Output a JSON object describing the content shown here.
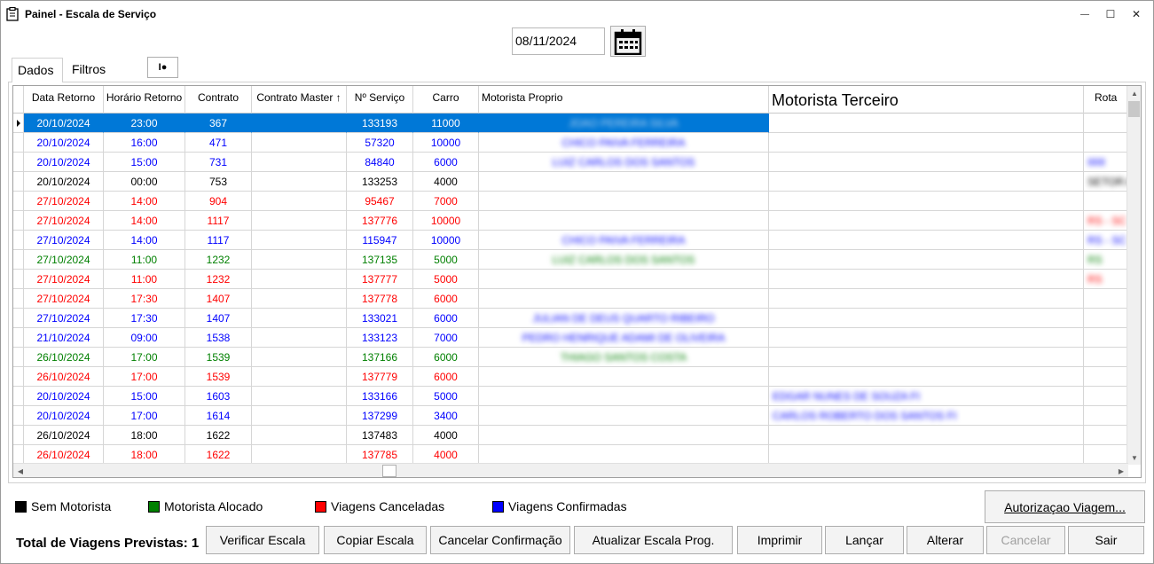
{
  "window": {
    "title": "Painel - Escala de Serviço",
    "minimize_glyph": "—",
    "maximize_glyph": "☐",
    "close_glyph": "✕"
  },
  "date_field": {
    "value": "08/11/2024"
  },
  "tabs": [
    {
      "label": "Dados"
    },
    {
      "label": "Filtros"
    }
  ],
  "small_button": {
    "glyph": "I●"
  },
  "grid": {
    "columns": [
      "Data Retorno",
      "Horário Retorno",
      "Contrato",
      "Contrato Master ↑",
      "Nº Serviço",
      "Carro",
      "Motorista Proprio",
      "Motorista Terceiro",
      "Rota"
    ],
    "rows": [
      {
        "date": "20/10/2024",
        "time": "23:00",
        "contract": "367",
        "master": "",
        "service": "133193",
        "car": "11000",
        "color": "#ffffff",
        "selected": true,
        "own_driver": "JOAO PEREIRA SILVA",
        "third_driver": "",
        "route": ""
      },
      {
        "date": "20/10/2024",
        "time": "16:00",
        "contract": "471",
        "master": "",
        "service": "57320",
        "car": "10000",
        "color": "#0000ff",
        "selected": false,
        "own_driver": "CHICO PAIVA FERREIRA",
        "third_driver": "",
        "route": ""
      },
      {
        "date": "20/10/2024",
        "time": "15:00",
        "contract": "731",
        "master": "",
        "service": "84840",
        "car": "6000",
        "color": "#0000ff",
        "selected": false,
        "own_driver": "LUIZ CARLOS DOS SANTOS",
        "third_driver": "",
        "route": "IIIIII"
      },
      {
        "date": "20/10/2024",
        "time": "00:00",
        "contract": "753",
        "master": "",
        "service": "133253",
        "car": "4000",
        "color": "#000000",
        "selected": false,
        "own_driver": "",
        "third_driver": "",
        "route": "SETOR A"
      },
      {
        "date": "27/10/2024",
        "time": "14:00",
        "contract": "904",
        "master": "",
        "service": "95467",
        "car": "7000",
        "color": "#ff0000",
        "selected": false,
        "own_driver": "",
        "third_driver": "",
        "route": ""
      },
      {
        "date": "27/10/2024",
        "time": "14:00",
        "contract": "1117",
        "master": "",
        "service": "137776",
        "car": "10000",
        "color": "#ff0000",
        "selected": false,
        "own_driver": "",
        "third_driver": "",
        "route": "RS - SC"
      },
      {
        "date": "27/10/2024",
        "time": "14:00",
        "contract": "1117",
        "master": "",
        "service": "115947",
        "car": "10000",
        "color": "#0000ff",
        "selected": false,
        "own_driver": "CHICO PAIVA FERREIRA",
        "third_driver": "",
        "route": "RS - SC"
      },
      {
        "date": "27/10/2024",
        "time": "11:00",
        "contract": "1232",
        "master": "",
        "service": "137135",
        "car": "5000",
        "color": "#008000",
        "selected": false,
        "own_driver": "LUIZ CARLOS DOS SANTOS",
        "third_driver": "",
        "route": "RS"
      },
      {
        "date": "27/10/2024",
        "time": "11:00",
        "contract": "1232",
        "master": "",
        "service": "137777",
        "car": "5000",
        "color": "#ff0000",
        "selected": false,
        "own_driver": "",
        "third_driver": "",
        "route": "RS"
      },
      {
        "date": "27/10/2024",
        "time": "17:30",
        "contract": "1407",
        "master": "",
        "service": "137778",
        "car": "6000",
        "color": "#ff0000",
        "selected": false,
        "own_driver": "",
        "third_driver": "",
        "route": ""
      },
      {
        "date": "27/10/2024",
        "time": "17:30",
        "contract": "1407",
        "master": "",
        "service": "133021",
        "car": "6000",
        "color": "#0000ff",
        "selected": false,
        "own_driver": "JULIAN DE DEUS QUARTO RIBEIRO",
        "third_driver": "",
        "route": ""
      },
      {
        "date": "21/10/2024",
        "time": "09:00",
        "contract": "1538",
        "master": "",
        "service": "133123",
        "car": "7000",
        "color": "#0000ff",
        "selected": false,
        "own_driver": "PEDRO HENRIQUE ADAMI DE OLIVEIRA",
        "third_driver": "",
        "route": ""
      },
      {
        "date": "26/10/2024",
        "time": "17:00",
        "contract": "1539",
        "master": "",
        "service": "137166",
        "car": "6000",
        "color": "#008000",
        "selected": false,
        "own_driver": "THIAGO SANTOS COSTA",
        "third_driver": "",
        "route": ""
      },
      {
        "date": "26/10/2024",
        "time": "17:00",
        "contract": "1539",
        "master": "",
        "service": "137779",
        "car": "6000",
        "color": "#ff0000",
        "selected": false,
        "own_driver": "",
        "third_driver": "",
        "route": ""
      },
      {
        "date": "20/10/2024",
        "time": "15:00",
        "contract": "1603",
        "master": "",
        "service": "133166",
        "car": "5000",
        "color": "#0000ff",
        "selected": false,
        "own_driver": "",
        "third_driver": "EDGAR NUNES DE SOUZA FI",
        "route": ""
      },
      {
        "date": "20/10/2024",
        "time": "17:00",
        "contract": "1614",
        "master": "",
        "service": "137299",
        "car": "3400",
        "color": "#0000ff",
        "selected": false,
        "own_driver": "",
        "third_driver": "CARLOS ROBERTO DOS SANTOS FI",
        "route": ""
      },
      {
        "date": "26/10/2024",
        "time": "18:00",
        "contract": "1622",
        "master": "",
        "service": "137483",
        "car": "4000",
        "color": "#000000",
        "selected": false,
        "own_driver": "",
        "third_driver": "",
        "route": ""
      },
      {
        "date": "26/10/2024",
        "time": "18:00",
        "contract": "1622",
        "master": "",
        "service": "137785",
        "car": "4000",
        "color": "#ff0000",
        "selected": false,
        "own_driver": "",
        "third_driver": "",
        "route": ""
      }
    ]
  },
  "legend": [
    {
      "label": "Sem Motorista",
      "color": "#000000"
    },
    {
      "label": "Motorista Alocado",
      "color": "#008000"
    },
    {
      "label": "Viagens Canceladas",
      "color": "#ff0000"
    },
    {
      "label": "Viagens Confirmadas",
      "color": "#0000ff"
    }
  ],
  "total_label": "Total de Viagens Previstas: 1",
  "buttons": {
    "autorizacao": "Autorizaçao Viagem...",
    "verificar": "Verificar Escala",
    "copiar": "Copiar Escala",
    "cancelar_confirmacao": "Cancelar Confirmação",
    "atualizar": "Atualizar Escala Prog.",
    "imprimir": "Imprimir",
    "lancar": "Lançar",
    "alterar": "Alterar",
    "cancelar": "Cancelar",
    "sair": "Sair"
  }
}
